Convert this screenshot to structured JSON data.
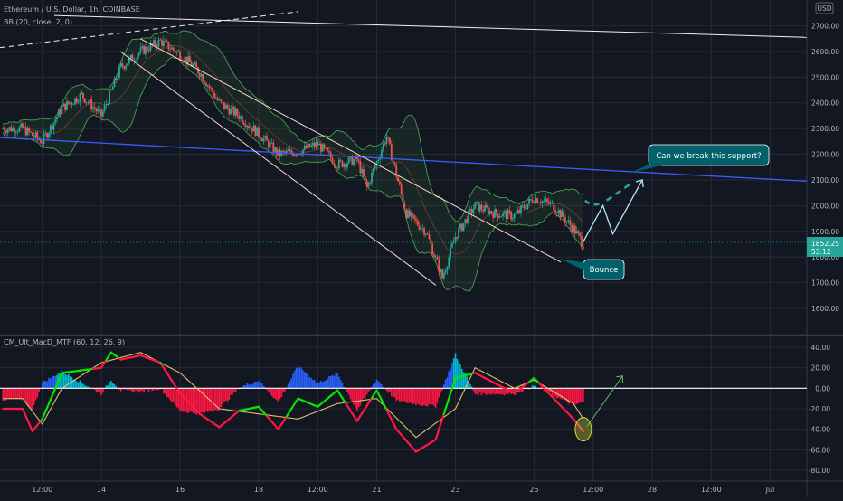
{
  "header": {
    "symbol_line": "Ethereum / U.S. Dollar, 1h, COINBASE",
    "bb_line": "BB (20, close, 2, 0)",
    "currency": "USD"
  },
  "macd_label": "CM_Ult_MacD_MTF (60, 12, 26, 9)",
  "price_badge": {
    "price": "1852.25",
    "countdown": "53:12"
  },
  "callouts": {
    "support": "Can we break this support?",
    "bounce": "Bounce"
  },
  "colors": {
    "background": "#131722",
    "grid": "#2a2e39",
    "bull_candle": "#26a69a",
    "bear_candle": "#ef5350",
    "bb_band": "#4caf50",
    "trend_line": "#3d5afe",
    "channel_line": "#f8d9c8",
    "callout": "#00606b",
    "macd_line": "#00e600",
    "signal_line": "#e0c070",
    "hist_up": "#00bcd4",
    "hist_down": "#ff1744",
    "projection": "#b2ebf2",
    "projection_dash": "#26a69a"
  },
  "chart_data": [
    {
      "type": "candlestick",
      "y_ticks": [
        1600,
        1700,
        1800,
        1900,
        2000,
        2100,
        2200,
        2300,
        2400,
        2500,
        2600,
        2700
      ],
      "ylim": [
        1555,
        2790
      ],
      "x_ticks": [
        "12:00",
        "14",
        "16",
        "18",
        "12:00",
        "21",
        "23",
        "25",
        "12:00",
        "28",
        "12:00",
        "Jul"
      ],
      "close_path": [
        [
          "Jun 12 00:00",
          2300
        ],
        [
          "Jun 12 12:00",
          2250
        ],
        [
          "Jun 13 00:00",
          2380
        ],
        [
          "Jun 13 12:00",
          2430
        ],
        [
          "Jun 14 00:00",
          2350
        ],
        [
          "Jun 14 12:00",
          2540
        ],
        [
          "Jun 15 00:00",
          2600
        ],
        [
          "Jun 15 12:00",
          2640
        ],
        [
          "Jun 16 00:00",
          2590
        ],
        [
          "Jun 16 12:00",
          2520
        ],
        [
          "Jun 17 00:00",
          2400
        ],
        [
          "Jun 17 12:00",
          2350
        ],
        [
          "Jun 18 00:00",
          2280
        ],
        [
          "Jun 18 12:00",
          2200
        ],
        [
          "Jun 19 00:00",
          2210
        ],
        [
          "Jun 19 12:00",
          2240
        ],
        [
          "Jun 20 00:00",
          2160
        ],
        [
          "Jun 20 12:00",
          2180
        ],
        [
          "Jun 20 18:00",
          2070
        ],
        [
          "Jun 21 06:00",
          2270
        ],
        [
          "Jun 21 18:00",
          1970
        ],
        [
          "Jun 22 06:00",
          1900
        ],
        [
          "Jun 22 16:00",
          1720
        ],
        [
          "Jun 23 00:00",
          1880
        ],
        [
          "Jun 23 12:00",
          2000
        ],
        [
          "Jun 24 00:00",
          1970
        ],
        [
          "Jun 24 12:00",
          1960
        ],
        [
          "Jun 25 00:00",
          2030
        ],
        [
          "Jun 25 12:00",
          2000
        ],
        [
          "Jun 26 00:00",
          1910
        ],
        [
          "Jun 26 06:00",
          1852.25
        ]
      ],
      "projection": [
        [
          "Jun 26 06:00",
          1860
        ],
        [
          "Jun 26 18:00",
          2000
        ],
        [
          "Jun 27 00:00",
          1890
        ],
        [
          "Jun 27 18:00",
          2100
        ]
      ],
      "last_price": 1852.25,
      "annotations": [
        "Can we break this support?",
        "Bounce"
      ]
    },
    {
      "type": "histogram+line",
      "title": "CM_Ult_MacD_MTF (60, 12, 26, 9)",
      "y_ticks": [
        40,
        20,
        0,
        -20,
        -40,
        -60,
        -80
      ],
      "ylim": [
        -90,
        50
      ],
      "macd": [
        [
          "Jun 12 00:00",
          -20
        ],
        [
          "Jun 12 06:00",
          -42
        ],
        [
          "Jun 12 12:00",
          -30
        ],
        [
          "Jun 13 00:00",
          15
        ],
        [
          "Jun 14 00:00",
          20
        ],
        [
          "Jun 14 06:00",
          35
        ],
        [
          "Jun 14 12:00",
          28
        ],
        [
          "Jun 15 00:00",
          32
        ],
        [
          "Jun 15 12:00",
          25
        ],
        [
          "Jun 16 00:00",
          -5
        ],
        [
          "Jun 16 12:00",
          -25
        ],
        [
          "Jun 17 00:00",
          -38
        ],
        [
          "Jun 17 12:00",
          -22
        ],
        [
          "Jun 18 00:00",
          -18
        ],
        [
          "Jun 18 12:00",
          -40
        ],
        [
          "Jun 19 00:00",
          -10
        ],
        [
          "Jun 19 12:00",
          -18
        ],
        [
          "Jun 20 00:00",
          -2
        ],
        [
          "Jun 20 12:00",
          -32
        ],
        [
          "Jun 21 00:00",
          -2
        ],
        [
          "Jun 21 12:00",
          -40
        ],
        [
          "Jun 22 00:00",
          -62
        ],
        [
          "Jun 22 12:00",
          -50
        ],
        [
          "Jun 23 00:00",
          10
        ],
        [
          "Jun 23 12:00",
          15
        ],
        [
          "Jun 24 00:00",
          5
        ],
        [
          "Jun 24 12:00",
          -5
        ],
        [
          "Jun 25 00:00",
          10
        ],
        [
          "Jun 25 12:00",
          -10
        ],
        [
          "Jun 26 00:00",
          -30
        ],
        [
          "Jun 26 06:00",
          -42
        ]
      ],
      "signal": [
        [
          "Jun 12 00:00",
          -10
        ],
        [
          "Jun 12 12:00",
          -35
        ],
        [
          "Jun 13 00:00",
          0
        ],
        [
          "Jun 14 00:00",
          25
        ],
        [
          "Jun 15 00:00",
          35
        ],
        [
          "Jun 16 00:00",
          15
        ],
        [
          "Jun 17 00:00",
          -20
        ],
        [
          "Jun 18 00:00",
          -25
        ],
        [
          "Jun 19 00:00",
          -30
        ],
        [
          "Jun 20 00:00",
          -15
        ],
        [
          "Jun 21 00:00",
          -10
        ],
        [
          "Jun 22 00:00",
          -48
        ],
        [
          "Jun 23 00:00",
          -20
        ],
        [
          "Jun 23 12:00",
          20
        ],
        [
          "Jun 24 12:00",
          0
        ],
        [
          "Jun 25 00:00",
          8
        ],
        [
          "Jun 26 00:00",
          -15
        ],
        [
          "Jun 26 06:00",
          -30
        ]
      ],
      "projection": [
        [
          "Jun 26 06:00",
          -40
        ],
        [
          "Jun 27 06:00",
          12
        ]
      ]
    }
  ]
}
